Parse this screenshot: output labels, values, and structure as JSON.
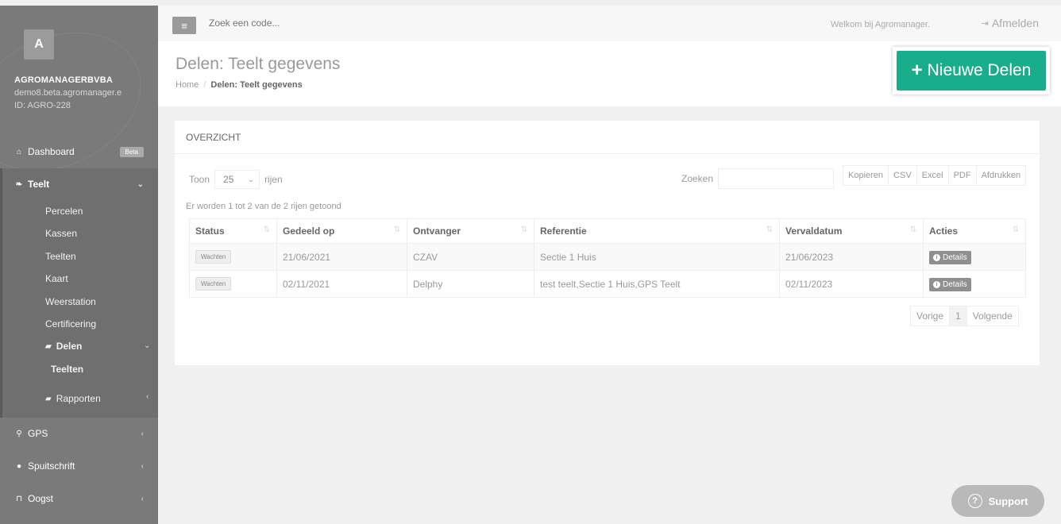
{
  "sidebar": {
    "avatar_letter": "A",
    "company": "AGROMANAGERBVBA",
    "domain": "demo8.beta.agromanager.e",
    "account_id": "ID: AGRO-228",
    "dashboard": "Dashboard",
    "dashboard_badge": "Beta",
    "teelt": "Teelt",
    "teelt_items": [
      "Percelen",
      "Kassen",
      "Teelten",
      "Kaart",
      "Weerstation",
      "Certificering"
    ],
    "delen": "Delen",
    "delen_sub": "Teelten",
    "rapporten": "Rapporten",
    "gps": "GPS",
    "spuitschrift": "Spuitschrift",
    "oogst": "Oogst"
  },
  "topbar": {
    "search_placeholder": "Zoek een code...",
    "welcome": "Welkom bij Agromanager.",
    "logout": "Afmelden"
  },
  "header": {
    "title": "Delen: Teelt gegevens",
    "breadcrumb_home": "Home",
    "breadcrumb_current": "Delen: Teelt gegevens",
    "new_button": "Nieuwe Delen"
  },
  "panel": {
    "title": "OVERZICHT",
    "show_label": "Toon",
    "page_size": "25",
    "rows_label": "rijen",
    "search_label": "Zoeken",
    "export": [
      "Kopieren",
      "CSV",
      "Excel",
      "PDF",
      "Afdrukken"
    ],
    "info": "Er worden 1 tot 2 van de 2 rijen getoond",
    "columns": [
      "Status",
      "Gedeeld op",
      "Ontvanger",
      "Referentie",
      "Vervaldatum",
      "Acties"
    ],
    "rows": [
      {
        "status": "Wachten",
        "shared": "21/06/2021",
        "recipient": "CZAV",
        "reference": "Sectie 1 Huis",
        "expiry": "21/06/2023",
        "action": "Details"
      },
      {
        "status": "Wachten",
        "shared": "02/11/2021",
        "recipient": "Delphy",
        "reference": "test teelt,Sectie 1 Huis,GPS Teelt",
        "expiry": "02/11/2023",
        "action": "Details"
      }
    ],
    "pager_prev": "Vorige",
    "pager_current": "1",
    "pager_next": "Volgende"
  },
  "support": "Support",
  "colors": {
    "accent": "#1aad8c",
    "sidebar": "#7a7a7a"
  }
}
